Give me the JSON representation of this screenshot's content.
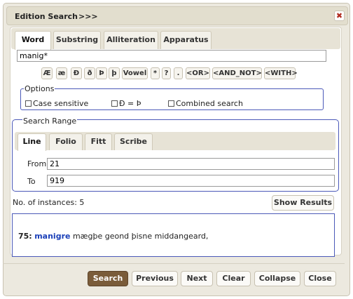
{
  "dialog": {
    "title": "Edition Search",
    "title_suffix": ">>>",
    "close_glyph": "✖"
  },
  "tabs": [
    {
      "label": "Word",
      "active": true
    },
    {
      "label": "Substring",
      "active": false
    },
    {
      "label": "Alliteration",
      "active": false
    },
    {
      "label": "Apparatus",
      "active": false
    }
  ],
  "query": {
    "value": "manig*"
  },
  "symbols": [
    "Æ",
    "æ",
    "Ð",
    "ð",
    "Þ",
    "þ",
    "Vowel",
    "*",
    "?",
    ".",
    "<OR>",
    "<AND_NOT>",
    "<WITH>"
  ],
  "options": {
    "legend": "Options",
    "case_sensitive": "Case sensitive",
    "eth_thorn": "Ð = Þ",
    "combined": "Combined search"
  },
  "range": {
    "legend": "Search Range",
    "tabs": [
      {
        "label": "Line",
        "active": true
      },
      {
        "label": "Folio",
        "active": false
      },
      {
        "label": "Fitt",
        "active": false
      },
      {
        "label": "Scribe",
        "active": false
      }
    ],
    "from_label": "From",
    "from_value": "21",
    "to_label": "To",
    "to_value": "919"
  },
  "instances_text": "No. of instances: 5",
  "show_results_label": "Show Results",
  "result": {
    "number": "75:",
    "hit": "manigre",
    "rest": " mægþe geond þisne middangeard,"
  },
  "footer": {
    "search": "Search",
    "previous": "Previous",
    "next": "Next",
    "clear": "Clear",
    "collapse": "Collapse",
    "close": "Close"
  },
  "colors": {
    "accent": "#7a5c3a",
    "fieldset_border": "#4b59b8",
    "hit": "#1a3fb8"
  }
}
